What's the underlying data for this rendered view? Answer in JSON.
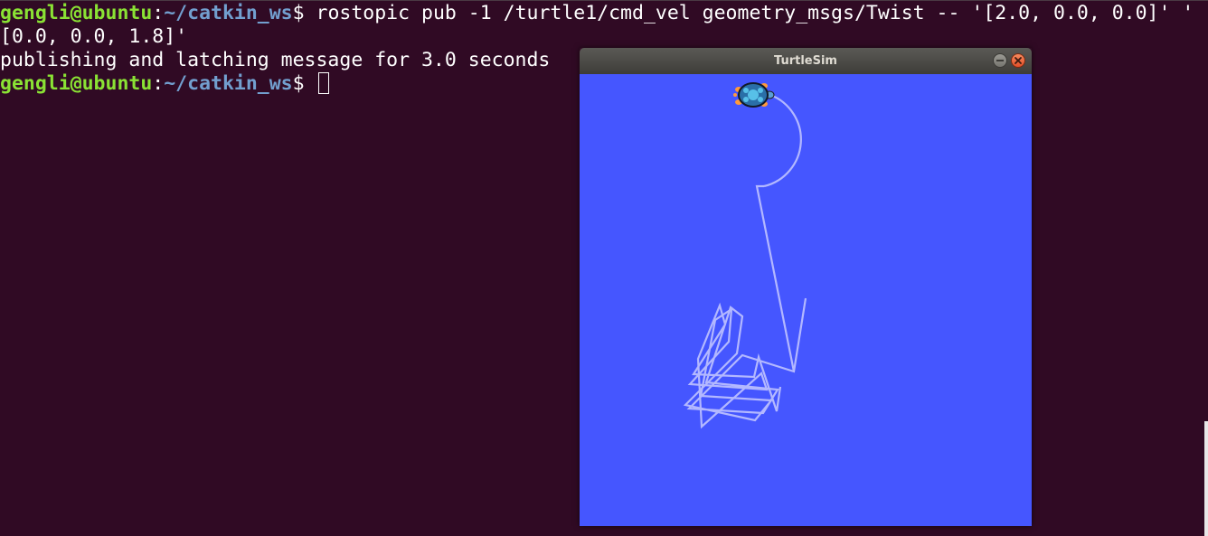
{
  "terminal": {
    "line1": {
      "user": "gengli@ubuntu",
      "sep": ":",
      "path": "~/catkin_ws",
      "prompt": "$ ",
      "command": "rostopic pub -1 /turtle1/cmd_vel geometry_msgs/Twist -- '[2.0, 0.0, 0.0]' '"
    },
    "line2": "[0.0, 0.0, 1.8]'",
    "line3": "publishing and latching message for 3.0 seconds",
    "line4": {
      "user": "gengli@ubuntu",
      "sep": ":",
      "path": "~/catkin_ws",
      "prompt": "$ "
    }
  },
  "turtlesim": {
    "title": "TurtleSim",
    "background_color": "#4556ff",
    "pen_color": "#b3b8ff",
    "buttons": [
      "minimize-icon",
      "close-icon"
    ]
  }
}
